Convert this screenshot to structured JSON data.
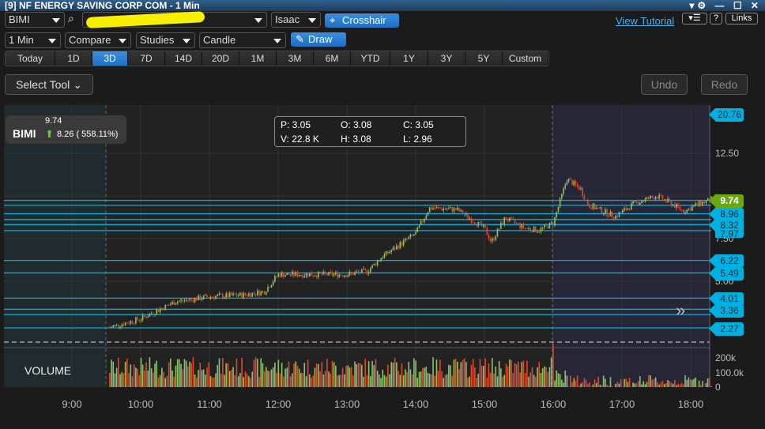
{
  "window": {
    "title": "[9] NF ENERGY SAVING CORP COM - 1 Min",
    "controls": "▾⚙ — ☐ ✕"
  },
  "toolbar": {
    "symbol": "BIMI",
    "account": "Isaac",
    "crosshair": "Crosshair",
    "view_tutorial": "View Tutorial",
    "help": "?",
    "links": "Links",
    "menu": "▾☰",
    "interval": "1 Min",
    "compare": "Compare",
    "studies": "Studies",
    "chart_type": "Candle",
    "draw": "Draw",
    "ranges": [
      "Today",
      "1D",
      "3D",
      "7D",
      "14D",
      "20D",
      "1M",
      "3M",
      "6M",
      "YTD",
      "1Y",
      "3Y",
      "5Y",
      "Custom"
    ],
    "active_range": "3D",
    "select_tool": "Select Tool",
    "undo": "Undo",
    "redo": "Redo"
  },
  "quote": {
    "symbol": "BIMI",
    "last": "9.74",
    "change": "8.26 ( 558.11%)"
  },
  "ohlc": {
    "p": "P: 3.05",
    "o": "O: 3.08",
    "c": "C: 3.05",
    "v": "V: 22.8 K",
    "h": "H: 3.08",
    "l": "L: 2.96"
  },
  "volume_label": "VOLUME",
  "price_axis": [
    "12.50",
    "7.50",
    "5.00"
  ],
  "volume_axis": [
    "200k",
    "100.0k",
    "0"
  ],
  "time_axis": [
    "9:00",
    "10:00",
    "11:00",
    "12:00",
    "13:00",
    "14:00",
    "15:00",
    "16:00",
    "17:00",
    "18:00"
  ],
  "price_tags": [
    "20.76",
    "9.74",
    "8.96",
    "8.32",
    "7.97",
    "6.22",
    "5.49",
    "4.01",
    "3.36",
    "2.27"
  ],
  "level_lines": [
    9.74,
    9.45,
    8.96,
    8.62,
    8.32,
    7.97,
    6.22,
    5.49,
    4.01,
    3.36,
    3.05,
    2.27
  ],
  "colors": {
    "up": "#8dc26b",
    "down": "#e0492c",
    "accent": "#00b0e0",
    "last": "#6aa812"
  },
  "chart_data": {
    "type": "candlestick",
    "xlabel": "time",
    "ylim": [
      0,
      13.5
    ],
    "keyframes_hour": [
      9.55,
      10,
      10.5,
      11,
      11.5,
      11.8,
      12,
      12.5,
      13,
      13.3,
      13.5,
      14,
      14.2,
      14.6,
      15,
      15.1,
      15.3,
      15.6,
      15.8,
      16,
      16.2,
      16.4,
      16.5,
      16.9,
      17.2,
      17.5,
      17.7,
      17.9,
      18.1,
      18.3
    ],
    "keyframes_price": [
      2.3,
      2.8,
      3.8,
      4.1,
      4.2,
      4.4,
      5.4,
      5.4,
      5.4,
      5.6,
      6.4,
      7.8,
      9.3,
      9.2,
      8.1,
      7.3,
      8.7,
      8.1,
      8.0,
      8.4,
      11.0,
      10.4,
      9.5,
      8.8,
      9.6,
      10.0,
      9.6,
      9.1,
      9.5,
      9.8
    ]
  }
}
